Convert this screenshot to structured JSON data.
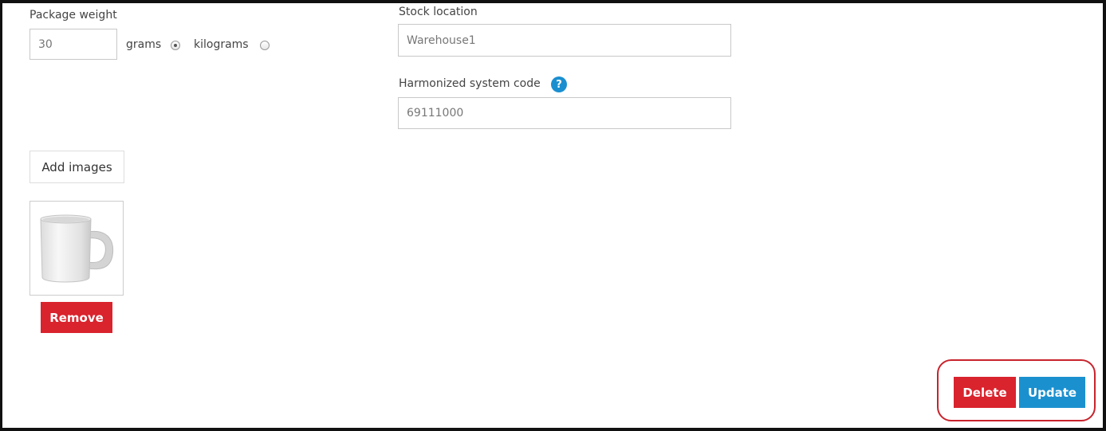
{
  "package_weight": {
    "label": "Package weight",
    "value": "30",
    "units": [
      {
        "label": "grams",
        "selected": true
      },
      {
        "label": "kilograms",
        "selected": false
      }
    ]
  },
  "stock_location": {
    "label": "Stock location",
    "value": "Warehouse1"
  },
  "harmonized_code": {
    "label": "Harmonized system code",
    "help_icon": "question-mark",
    "value": "69111000"
  },
  "images": {
    "add_label": "Add images",
    "remove_label": "Remove",
    "thumbnail": "white-mug-image"
  },
  "actions": {
    "delete_label": "Delete",
    "update_label": "Update"
  },
  "colors": {
    "danger": "#d9232d",
    "primary": "#1b90cf",
    "annotation": "#c8232c"
  }
}
